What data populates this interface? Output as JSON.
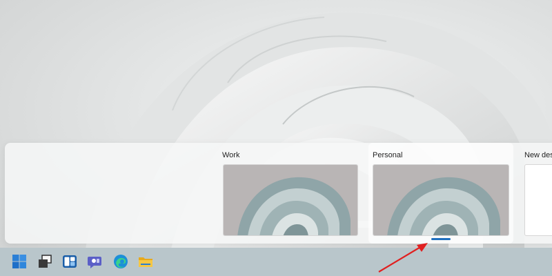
{
  "desktop_switcher": {
    "desktops": [
      {
        "label": "Work",
        "active": false
      },
      {
        "label": "Personal",
        "active": true
      },
      {
        "label": "New desktop",
        "active": false
      }
    ]
  },
  "taskbar": {
    "icons": [
      {
        "name": "start-icon"
      },
      {
        "name": "task-view-icon"
      },
      {
        "name": "widgets-icon"
      },
      {
        "name": "chat-icon"
      },
      {
        "name": "edge-icon"
      },
      {
        "name": "file-explorer-icon"
      }
    ]
  },
  "colors": {
    "accent": "#1e6fbf",
    "annotation_arrow": "#e02020",
    "taskbar": "#b9c6cb"
  }
}
